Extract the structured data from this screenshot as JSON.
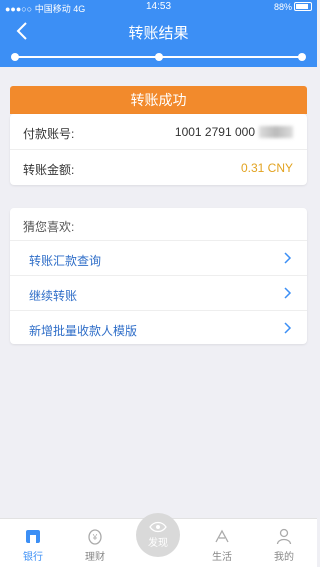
{
  "status_bar": {
    "signal": "●●●○○",
    "carrier": "中国移动",
    "network": "4G",
    "time": "14:53",
    "battery": "88%"
  },
  "header": {
    "title": "转账结果",
    "progress_fraction": 1.0
  },
  "result": {
    "banner": "转账成功",
    "rows": [
      {
        "label": "付款账号:",
        "value": "1001 2791 000"
      },
      {
        "label": "转账金额:",
        "value": "0.31 CNY"
      }
    ],
    "accent_color": "#f28a2c",
    "amount_color": "#e2a321"
  },
  "suggest": {
    "heading": "猜您喜欢:",
    "items": [
      {
        "label": "转账汇款查询"
      },
      {
        "label": "继续转账"
      },
      {
        "label": "新增批量收款人模版"
      }
    ]
  },
  "tabbar": {
    "tabs": [
      {
        "label": "银行",
        "icon": "bank-icon",
        "active": true
      },
      {
        "label": "理财",
        "icon": "wealth-icon",
        "active": false
      },
      {
        "label": "生活",
        "icon": "life-icon",
        "active": false
      },
      {
        "label": "我的",
        "icon": "person-icon",
        "active": false
      }
    ],
    "discover": {
      "label": "发现",
      "icon": "eye-icon"
    }
  },
  "colors": {
    "brand_blue": "#3c8ff5",
    "link_blue": "#2f6ec8"
  }
}
